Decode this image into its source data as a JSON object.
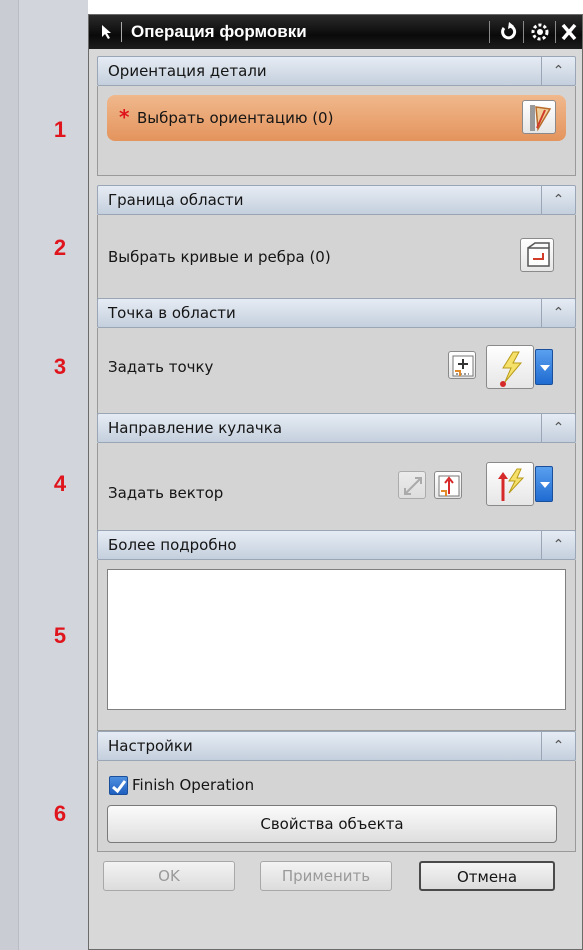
{
  "step_numbers": [
    "1",
    "2",
    "3",
    "4",
    "5",
    "6"
  ],
  "dialog": {
    "title": "Операция формовки",
    "titlebar_icons": [
      "pointer-arrow-icon",
      "reset-icon",
      "gear-icon",
      "close-icon"
    ]
  },
  "sections": {
    "part_orientation": {
      "header": "Ориентация детали",
      "select_label": "Выбрать ориентацию (0)",
      "required_marker": "*",
      "icon": "orientation-icon"
    },
    "region_boundary": {
      "header": "Граница области",
      "select_label": "Выбрать кривые и ребра (0)",
      "icon": "curve-select-icon"
    },
    "point_in_region": {
      "header": "Точка в области",
      "specify_label": "Задать точку",
      "icons": [
        "point-dialog-icon",
        "inferred-point-icon"
      ]
    },
    "cam_direction": {
      "header": "Направление кулачка",
      "specify_label": "Задать вектор",
      "icons": [
        "reverse-direction-icon",
        "vector-dialog-icon",
        "inferred-vector-icon"
      ]
    },
    "more_details": {
      "header": "Более подробно",
      "text_value": ""
    },
    "settings": {
      "header": "Настройки",
      "finish_operation_label": "Finish Operation",
      "finish_operation_checked": true,
      "object_properties_button": "Свойства объекта"
    }
  },
  "footer": {
    "ok_label": "OK",
    "apply_label": "Применить",
    "cancel_label": "Отмена"
  },
  "colors": {
    "highlight": "#e89a60",
    "step_number": "#e0141c",
    "titlebar": "#111111",
    "accent_blue": "#2f7ad8"
  }
}
